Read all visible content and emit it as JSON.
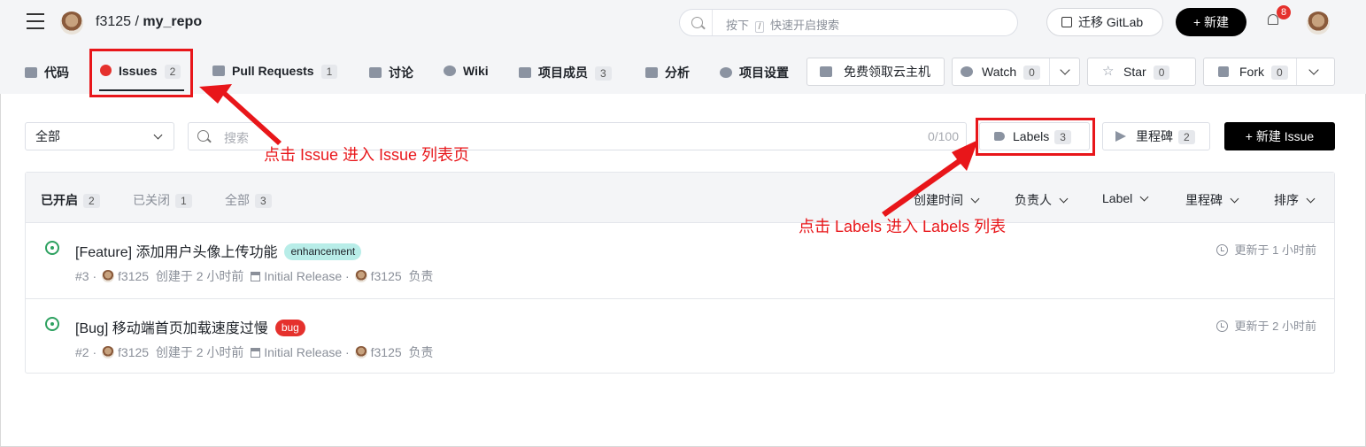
{
  "header": {
    "owner": "f3125",
    "separator": "/",
    "repo": "my_repo",
    "search_hint_prefix": "按下",
    "search_key": "/",
    "search_hint_suffix": "快速开启搜索",
    "migrate_label": "迁移 GitLab",
    "new_label": "+ 新建",
    "notification_count": "8"
  },
  "tabs": [
    {
      "label": "代码",
      "count": ""
    },
    {
      "label": "Issues",
      "count": "2"
    },
    {
      "label": "Pull Requests",
      "count": "1"
    },
    {
      "label": "讨论",
      "count": ""
    },
    {
      "label": "Wiki",
      "count": ""
    },
    {
      "label": "项目成员",
      "count": "3"
    },
    {
      "label": "分析",
      "count": ""
    },
    {
      "label": "项目设置",
      "count": ""
    }
  ],
  "repo_actions": {
    "cloud_label": "免费领取云主机",
    "watch_label": "Watch",
    "watch_count": "0",
    "star_label": "Star",
    "star_count": "0",
    "fork_label": "Fork",
    "fork_count": "0"
  },
  "filters": {
    "scope_value": "全部",
    "search_placeholder": "搜索",
    "search_counter": "0/100",
    "labels_label": "Labels",
    "labels_count": "3",
    "milestones_label": "里程碑",
    "milestones_count": "2",
    "new_issue_label": "+ 新建 Issue"
  },
  "list": {
    "state_tabs": [
      {
        "label": "已开启",
        "count": "2"
      },
      {
        "label": "已关闭",
        "count": "1"
      },
      {
        "label": "全部",
        "count": "3"
      }
    ],
    "sorts": [
      "创建时间",
      "负责人",
      "Label",
      "里程碑",
      "排序"
    ],
    "issues": [
      {
        "title": "[Feature] 添加用户头像上传功能",
        "label": "enhancement",
        "label_bg": "#b8ede8",
        "label_fg": "#1f2329",
        "number": "#3",
        "author": "f3125",
        "created": "创建于 2 小时前",
        "milestone": "Initial Release",
        "assignee": "f3125",
        "assignee_suffix": "负责",
        "updated": "更新于 1 小时前"
      },
      {
        "title": "[Bug] 移动端首页加载速度过慢",
        "label": "bug",
        "label_bg": "#e5312d",
        "label_fg": "#ffffff",
        "number": "#2",
        "author": "f3125",
        "created": "创建于 2 小时前",
        "milestone": "Initial Release",
        "assignee": "f3125",
        "assignee_suffix": "负责",
        "updated": "更新于 2 小时前"
      }
    ]
  },
  "annotations": {
    "issues_hint": "点击 Issue 进入 Issue 列表页",
    "labels_hint": "点击 Labels 进入 Labels 列表",
    "color": "#e8161a"
  }
}
